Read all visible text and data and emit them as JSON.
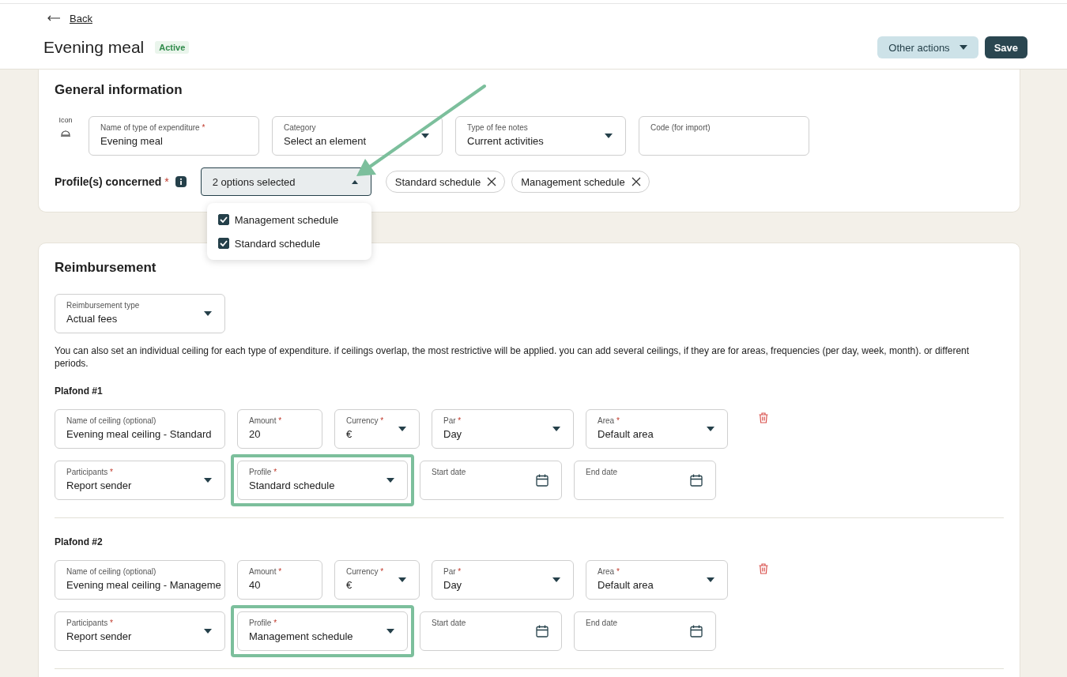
{
  "header": {
    "back": "Back",
    "title": "Evening meal",
    "status": "Active",
    "actions": [
      {
        "kind": "menu",
        "label": "Other actions"
      },
      {
        "kind": "primary",
        "label": "Save"
      }
    ]
  },
  "general": {
    "title": "General information",
    "icon_label": "Icon",
    "fields": [
      {
        "kind": "text",
        "label": "Name of type of expenditure",
        "required_mark": "*",
        "value": "Evening meal"
      },
      {
        "kind": "select",
        "label": "Category",
        "value": "Select an element"
      },
      {
        "kind": "select",
        "label": "Type of fee notes",
        "value": "Current activities"
      },
      {
        "kind": "text",
        "label": "Code (for import)"
      }
    ],
    "profiles": {
      "label": "Profile(s) concerned",
      "required_mark": "*",
      "value": "2 options selected",
      "expanded": true,
      "options": [
        {
          "label": "Management schedule",
          "checked": true
        },
        {
          "label": "Standard schedule",
          "checked": true
        }
      ],
      "chips": [
        "Standard schedule",
        "Management schedule"
      ]
    }
  },
  "reimbursement": {
    "title": "Reimbursement",
    "type_field": {
      "kind": "select",
      "label": "Reimbursement type",
      "value": "Actual fees"
    },
    "note": "You can also set an individual ceiling for each type of expenditure. if ceilings overlap, the most restrictive will be applied. you can add several ceilings, if they are for areas, frequencies (per day, week, month). or different periods.",
    "ceilings": [
      {
        "title": "Plafond #1",
        "fields": [
          {
            "kind": "text",
            "label": "Name of ceiling (optional)",
            "value": "Evening meal ceiling - Standard",
            "highlighted": false
          },
          {
            "kind": "text",
            "label": "Amount",
            "required_mark": "*",
            "value": "20",
            "highlighted": false
          },
          {
            "kind": "select",
            "label": "Currency",
            "required_mark": "*",
            "value": "€",
            "highlighted": false
          },
          {
            "kind": "select",
            "label": "Par",
            "required_mark": "*",
            "value": "Day",
            "highlighted": false
          },
          {
            "kind": "select",
            "label": "Area",
            "required_mark": "*",
            "value": "Default area",
            "highlighted": false
          },
          {
            "kind": "select",
            "label": "Participants",
            "required_mark": "*",
            "value": "Report sender",
            "highlighted": false
          },
          {
            "kind": "select",
            "label": "Profile",
            "required_mark": "*",
            "value": "Standard schedule",
            "highlighted": true
          },
          {
            "kind": "date",
            "label": "Start date",
            "highlighted": false
          },
          {
            "kind": "date",
            "label": "End date",
            "highlighted": false
          }
        ]
      },
      {
        "title": "Plafond #2",
        "fields": [
          {
            "kind": "text",
            "label": "Name of ceiling (optional)",
            "value": "Evening meal ceiling - Manageme",
            "highlighted": false
          },
          {
            "kind": "text",
            "label": "Amount",
            "required_mark": "*",
            "value": "40",
            "highlighted": false
          },
          {
            "kind": "select",
            "label": "Currency",
            "required_mark": "*",
            "value": "€",
            "highlighted": false
          },
          {
            "kind": "select",
            "label": "Par",
            "required_mark": "*",
            "value": "Day",
            "highlighted": false
          },
          {
            "kind": "select",
            "label": "Area",
            "required_mark": "*",
            "value": "Default area",
            "highlighted": false
          },
          {
            "kind": "select",
            "label": "Participants",
            "required_mark": "*",
            "value": "Report sender",
            "highlighted": false
          },
          {
            "kind": "select",
            "label": "Profile",
            "required_mark": "*",
            "value": "Management schedule",
            "highlighted": true
          },
          {
            "kind": "date",
            "label": "Start date",
            "highlighted": false
          },
          {
            "kind": "date",
            "label": "End date",
            "highlighted": false
          }
        ]
      }
    ]
  }
}
